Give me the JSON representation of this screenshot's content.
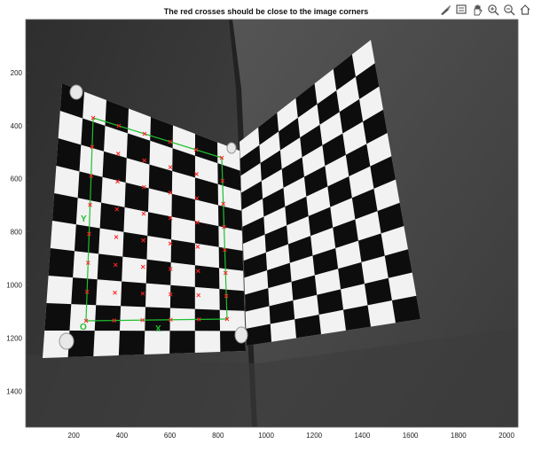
{
  "figure": {
    "title": "The red crosses should be close to the image corners"
  },
  "toolbar": {
    "icons": [
      "brush-icon",
      "data-tip-icon",
      "pan-icon",
      "zoom-in-icon",
      "zoom-out-icon",
      "home-icon"
    ]
  },
  "axes": {
    "x_ticks": [
      "200",
      "400",
      "600",
      "800",
      "1000",
      "1200",
      "1400",
      "1600",
      "1800",
      "2000"
    ],
    "y_ticks": [
      "200",
      "400",
      "600",
      "800",
      "1000",
      "1200",
      "1400"
    ],
    "x_tick_values": [
      200,
      400,
      600,
      800,
      1000,
      1200,
      1400,
      1600,
      1800,
      2000
    ],
    "y_tick_values": [
      200,
      400,
      600,
      800,
      1000,
      1200,
      1400
    ],
    "xlim": [
      0,
      2048
    ],
    "ylim": [
      0,
      1536
    ]
  },
  "overlay": {
    "origin_label": "O",
    "x_label": "X",
    "y_label": "Y",
    "grid_color": "#1fbf2f",
    "cross_color": "#ff2222"
  },
  "colors": {
    "background_wall": "#3a3a3a",
    "square_dark": "#0d0d0d",
    "square_light": "#f2f2f2"
  }
}
